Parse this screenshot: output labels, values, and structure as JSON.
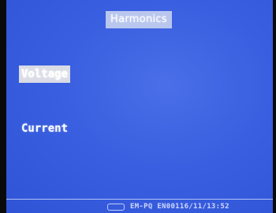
{
  "screen": {
    "title": "Harmonics"
  },
  "menu": {
    "items": [
      {
        "label": "Voltage",
        "selected": true
      },
      {
        "label": "Current",
        "selected": false
      }
    ]
  },
  "status_bar": {
    "icon": "link-icon",
    "text": "EM-PQ EN00116/11/13:52"
  }
}
